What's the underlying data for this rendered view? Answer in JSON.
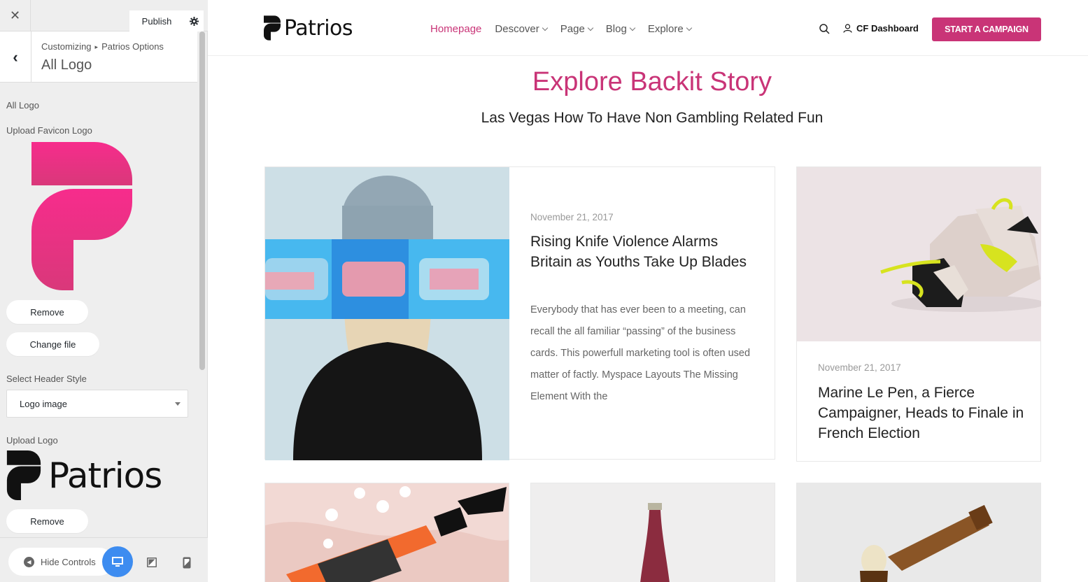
{
  "sidebar": {
    "publish_label": "Publish",
    "breadcrumb": [
      "Customizing",
      "Patrios Options"
    ],
    "section_title": "All Logo",
    "controls": {
      "heading": "All Logo",
      "favicon_label": "Upload Favicon Logo",
      "favicon_remove": "Remove",
      "favicon_change": "Change file",
      "header_style_label": "Select Header Style",
      "header_style_value": "Logo image",
      "logo_label": "Upload Logo",
      "logo_text": "Patrios",
      "logo_remove": "Remove"
    },
    "footer": {
      "hide_controls": "Hide Controls"
    }
  },
  "site": {
    "logo_text": "Patrios",
    "nav": [
      "Homepage",
      "Descover",
      "Page",
      "Blog",
      "Explore"
    ],
    "dashboard_link": "CF Dashboard",
    "campaign_button": "START A CAMPAIGN",
    "hero_title": "Explore Backit Story",
    "hero_subtitle": "Las Vegas How To Have Non Gambling Related Fun",
    "featured_post": {
      "date": "November 21, 2017",
      "title": "Rising Knife Violence Alarms Britain as Youths Take Up Blades",
      "excerpt": "Everybody that has ever been to a meeting, can recall the all familiar “passing” of the business cards. This powerfull marketing tool is often used matter of factly. Myspace Layouts The Missing Element With the"
    },
    "side_post": {
      "date": "November 21, 2017",
      "title": "Marine Le Pen, a Fierce Campaigner, Heads to Finale in French Election"
    }
  },
  "colors": {
    "accent": "#c93477",
    "favicon_gradient_top": "#f72c8c",
    "favicon_gradient_bottom": "#d9387a",
    "device_active": "#3d8cf0"
  }
}
